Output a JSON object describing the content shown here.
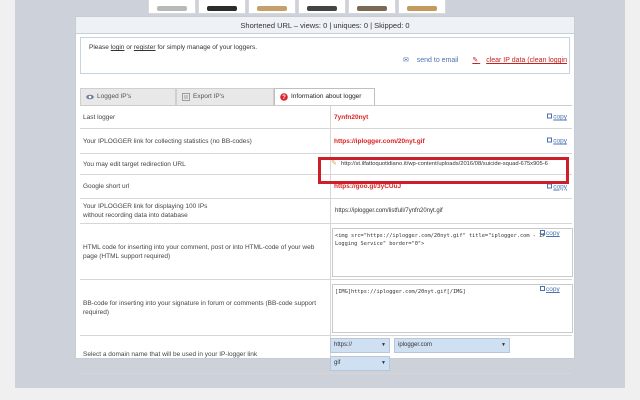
{
  "stats": {
    "shortened_url_label": "Shortened URL",
    "views_label": "views",
    "views": "0",
    "uniques_label": "uniques",
    "uniques": "0",
    "skipped_label": "Skipped",
    "skipped": "0"
  },
  "login": {
    "please": "Please",
    "login_link": "login",
    "or": "or",
    "register_link": "register",
    "rest": "for simply manage of your loggers.",
    "send_email": "send to email",
    "clear_ip": "clear IP data (clean loggin"
  },
  "tabs": [
    {
      "label": "Logged IP's"
    },
    {
      "label": "Export IP's"
    },
    {
      "label": "Information about logger"
    }
  ],
  "rows": {
    "last_logger": {
      "label": "Last logger",
      "value": "7ynfn20nyt",
      "copy": "copy"
    },
    "stats_link": {
      "label": "Your IPLOGGER link for collecting statistics (no BB-codes)",
      "value": "https://iplogger.com/20nyt.gif",
      "copy": "copy"
    },
    "redirect": {
      "label": "You may edit target redirection URL",
      "value": "http://st.ilfattoquotidiano.it/wp-content/uploads/2016/08/suicide-squad-675x905-6"
    },
    "google": {
      "label": "Google short url",
      "value": "https://goo.gl/3yCUuJ",
      "copy": "copy"
    },
    "display_100": {
      "label_line1": "Your IPLOGGER link for displaying 100 IPs",
      "label_line2": "without recording data into database",
      "value": "https://iplogger.com/listfull/7ynfn20nyt.gif"
    },
    "html_code": {
      "label": "HTML code for inserting into your comment, post or into HTML-code of your web page (HTML support required)",
      "value": "<img src=\"https://iplogger.com/20nyt.gif\" title=\"iplogger.com - IP Logging Service\" border=\"0\">",
      "copy": "copy"
    },
    "bb_code": {
      "label": "BB-code for inserting into your signature in forum or comments (BB-code support required)",
      "value": "[IMG]https://iplogger.com/20nyt.gif[/IMG]",
      "copy": "copy"
    },
    "domain": {
      "label": "Select  a domain name that will be used in your IP-logger link",
      "protocol": "https://",
      "domain": "iplogger.com",
      "ext": "gif"
    }
  },
  "colors": {
    "accent_red": "#cc1f2a",
    "link_blue": "#4b72b0"
  }
}
